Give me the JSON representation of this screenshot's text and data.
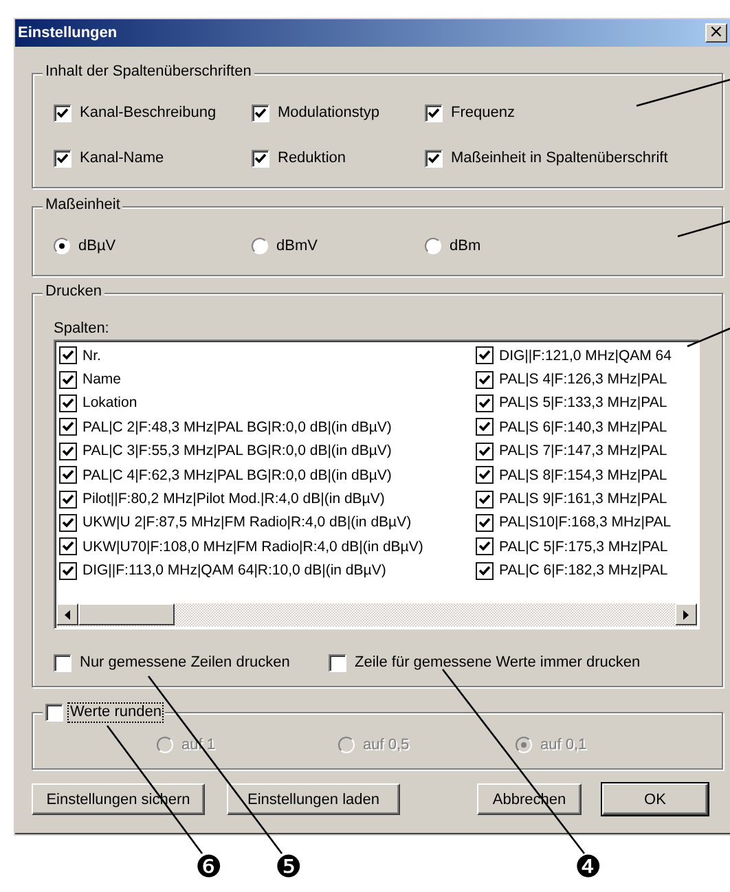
{
  "window": {
    "title": "Einstellungen",
    "close": "×"
  },
  "header_content": {
    "title": "Inhalt der Spaltenüberschriften",
    "options": [
      {
        "label": "Kanal-Beschreibung",
        "checked": true
      },
      {
        "label": "Modulationstyp",
        "checked": true
      },
      {
        "label": "Frequenz",
        "checked": true
      },
      {
        "label": "Kanal-Name",
        "checked": true
      },
      {
        "label": "Reduktion",
        "checked": true
      },
      {
        "label": "Maßeinheit in Spaltenüberschrift",
        "checked": true
      }
    ]
  },
  "unit": {
    "title": "Maßeinheit",
    "options": [
      {
        "label": "dBµV",
        "selected": true
      },
      {
        "label": "dBmV",
        "selected": false
      },
      {
        "label": "dBm",
        "selected": false
      }
    ]
  },
  "print": {
    "title": "Drucken",
    "columns_label": "Spalten:",
    "columns_left": [
      {
        "label": "Nr.",
        "checked": true
      },
      {
        "label": "Name",
        "checked": true
      },
      {
        "label": "Lokation",
        "checked": true
      },
      {
        "label": "PAL|C 2|F:48,3 MHz|PAL BG|R:0,0 dB|(in dBµV)",
        "checked": true
      },
      {
        "label": "PAL|C 3|F:55,3 MHz|PAL BG|R:0,0 dB|(in dBµV)",
        "checked": true
      },
      {
        "label": "PAL|C 4|F:62,3 MHz|PAL BG|R:0,0 dB|(in dBµV)",
        "checked": true
      },
      {
        "label": "Pilot||F:80,2 MHz|Pilot Mod.|R:4,0 dB|(in dBµV)",
        "checked": true
      },
      {
        "label": "UKW|U 2|F:87,5 MHz|FM Radio|R:4,0 dB|(in dBµV)",
        "checked": true
      },
      {
        "label": "UKW|U70|F:108,0 MHz|FM Radio|R:4,0 dB|(in dBµV)",
        "checked": true
      },
      {
        "label": "DIG||F:113,0 MHz|QAM 64|R:10,0 dB|(in dBµV)",
        "checked": true
      }
    ],
    "columns_right": [
      {
        "label": "DIG||F:121,0 MHz|QAM 64",
        "checked": true
      },
      {
        "label": "PAL|S 4|F:126,3 MHz|PAL",
        "checked": true
      },
      {
        "label": "PAL|S 5|F:133,3 MHz|PAL",
        "checked": true
      },
      {
        "label": "PAL|S 6|F:140,3 MHz|PAL",
        "checked": true
      },
      {
        "label": "PAL|S 7|F:147,3 MHz|PAL",
        "checked": true
      },
      {
        "label": "PAL|S 8|F:154,3 MHz|PAL",
        "checked": true
      },
      {
        "label": "PAL|S 9|F:161,3 MHz|PAL",
        "checked": true
      },
      {
        "label": "PAL|S10|F:168,3 MHz|PAL",
        "checked": true
      },
      {
        "label": "PAL|C 5|F:175,3 MHz|PAL",
        "checked": true
      },
      {
        "label": "PAL|C 6|F:182,3 MHz|PAL",
        "checked": true
      }
    ],
    "options": [
      {
        "label": "Nur gemessene Zeilen drucken",
        "checked": false
      },
      {
        "label": "Zeile für gemessene Werte immer drucken",
        "checked": false
      }
    ]
  },
  "rounding": {
    "label": "Werte runden",
    "checked": false,
    "focused": true,
    "options": [
      {
        "label": "auf 1",
        "selected": false,
        "disabled": true
      },
      {
        "label": "auf 0,5",
        "selected": false,
        "disabled": true
      },
      {
        "label": "auf 0,1",
        "selected": true,
        "disabled": true
      }
    ]
  },
  "buttons": [
    {
      "label": "Einstellungen sichern",
      "kind": "normal"
    },
    {
      "label": "Einstellungen laden",
      "kind": "normal"
    },
    {
      "label": "Abbrechen",
      "kind": "normal"
    },
    {
      "label": "OK",
      "kind": "default"
    }
  ],
  "callouts": [
    {
      "label": "❻"
    },
    {
      "label": "❺"
    },
    {
      "label": "❹"
    }
  ]
}
